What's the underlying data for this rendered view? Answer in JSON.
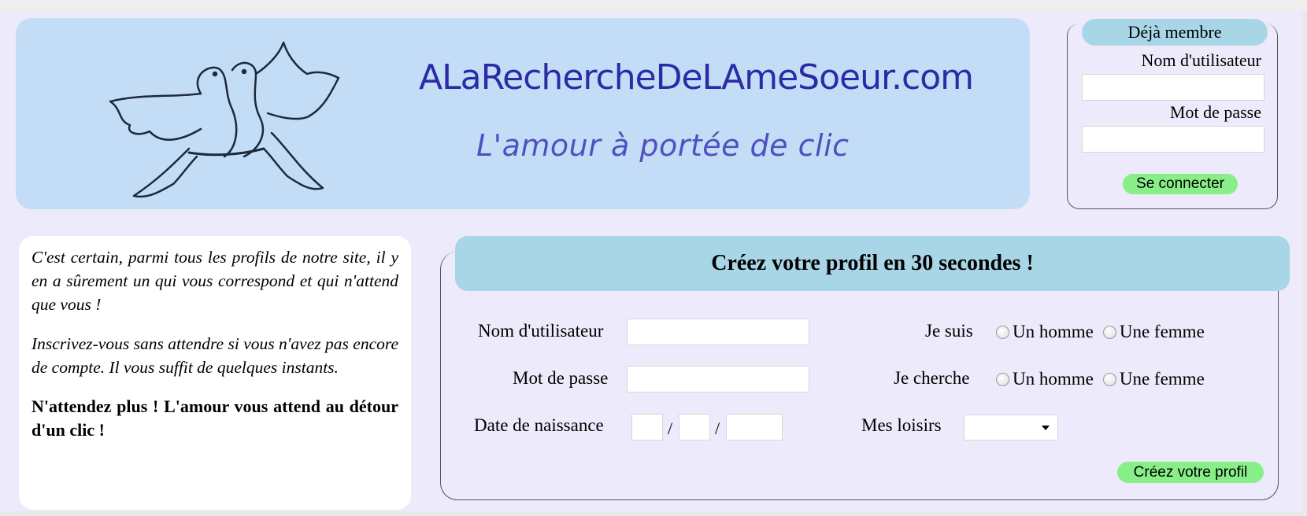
{
  "banner": {
    "site_title": "ALaRechercheDeLAmeSoeur.com",
    "slogan": "L'amour à portée de clic"
  },
  "login": {
    "header": "Déjà membre",
    "username_label": "Nom d'utilisateur",
    "username_value": "",
    "password_label": "Mot de passe",
    "password_value": "",
    "button_label": "Se connecter"
  },
  "intro": {
    "paragraph1": "C'est certain, parmi tous les profils de notre site, il y en a sûrement un qui vous correspond et qui n'attend que vous !",
    "paragraph2": "Inscrivez-vous sans attendre si vous n'avez pas encore de compte. Il vous suffit de quelques instants.",
    "paragraph3": "N'attendez plus ! L'amour vous attend au détour d'un clic !"
  },
  "signup": {
    "header": "Créez votre profil en 30 secondes !",
    "username_label": "Nom d'utilisateur",
    "password_label": "Mot de passe",
    "birthdate_label": "Date de naissance",
    "date_separator": "/",
    "i_am_label": "Je suis",
    "looking_for_label": "Je cherche",
    "option_man": "Un homme",
    "option_woman": "Une femme",
    "hobbies_label": "Mes loisirs",
    "hobbies_selected": "",
    "button_label": "Créez votre profil"
  },
  "colors": {
    "banner_bg": "#c4ddf6",
    "header_bg": "#a9d6e6",
    "button_bg": "#88ee88",
    "page_bg": "#edeafb",
    "title_color": "#2b2ba6"
  }
}
